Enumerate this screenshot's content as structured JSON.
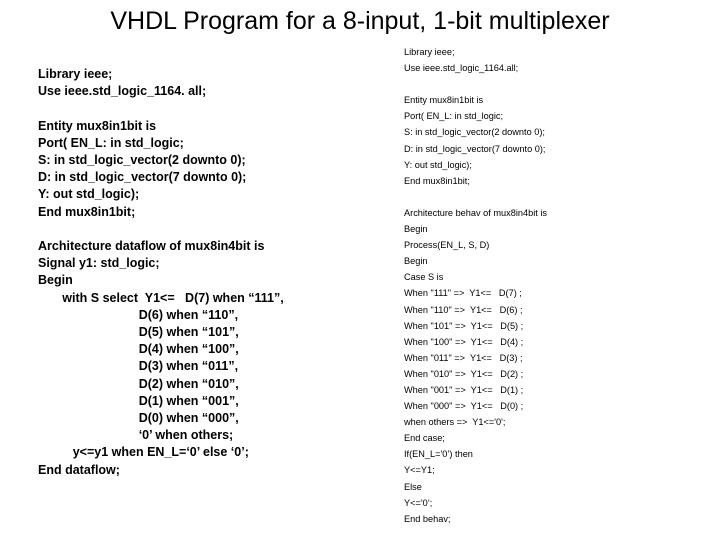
{
  "slide": {
    "title": "VHDL Program for a 8-input, 1-bit multiplexer",
    "background_color": "#ffffff",
    "text_color": "#000000"
  },
  "left_column": {
    "name": "dataflow-architecture-code",
    "style": "bold",
    "lines": [
      "Library ieee;",
      "Use ieee.std_logic_1164. all;",
      "",
      "Entity mux8in1bit is",
      "Port( EN_L: in std_logic;",
      "S: in std_logic_vector(2 downto 0);",
      "D: in std_logic_vector(7 downto 0);",
      "Y: out std_logic);",
      "End mux8in1bit;",
      "",
      "Architecture dataflow of mux8in4bit is",
      "Signal y1: std_logic;",
      "Begin",
      "       with S select  Y1<=   D(7) when “111”,",
      "                             D(6) when “110”,",
      "                             D(5) when “101”,",
      "                             D(4) when “100”,",
      "                             D(3) when “011”,",
      "                             D(2) when “010”,",
      "                             D(1) when “001”,",
      "                             D(0) when “000”,",
      "                             ‘0’ when others;",
      "          y<=y1 when EN_L=‘0’ else ‘0’;",
      "End dataflow;"
    ]
  },
  "right_column": {
    "name": "behavioral-architecture-code",
    "style": "regular",
    "lines": [
      "Library ieee;",
      "Use ieee.std_logic_1164.all;",
      "",
      "Entity mux8in1bit is",
      "Port( EN_L: in std_logic;",
      "S: in std_logic_vector(2 downto 0);",
      "D: in std_logic_vector(7 downto 0);",
      "Y: out std_logic);",
      "End mux8in1bit;",
      "",
      "Architecture behav of mux8in4bit is",
      "Begin",
      "Process(EN_L, S, D)",
      "Begin",
      "Case S is",
      "When \"111\" =>  Y1<=   D(7) ;",
      "When \"110\" =>  Y1<=   D(6) ;",
      "When \"101\" =>  Y1<=   D(5) ;",
      "When \"100\" =>  Y1<=   D(4) ;",
      "When \"011\" =>  Y1<=   D(3) ;",
      "When \"010\" =>  Y1<=   D(2) ;",
      "When \"001\" =>  Y1<=   D(1) ;",
      "When \"000\" =>  Y1<=   D(0) ;",
      "when others =>  Y1<='0';",
      "End case;",
      "If(EN_L='0’) then",
      "Y<=Y1;",
      "Else",
      "Y<='0’;",
      "End behav;"
    ]
  }
}
